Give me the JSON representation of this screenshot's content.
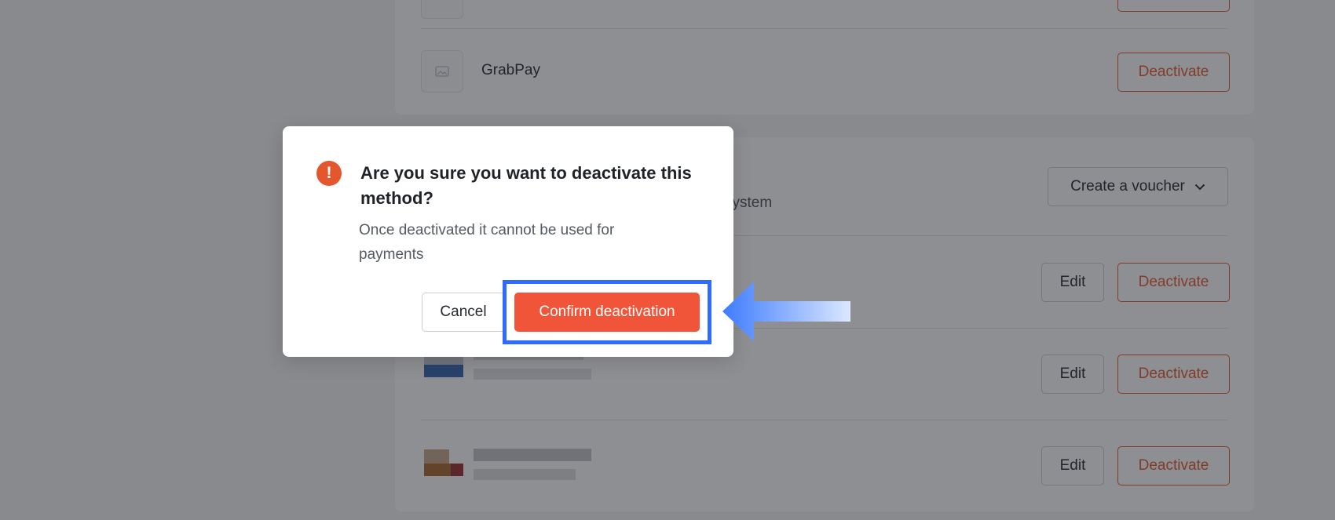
{
  "background": {
    "methods": [
      {
        "name": "GrabPay",
        "action_label": "Deactivate"
      }
    ],
    "voucher_section": {
      "subtitle_fragment": "system",
      "create_voucher_label": "Create a voucher"
    },
    "row_actions": {
      "edit_label": "Edit",
      "deactivate_label": "Deactivate"
    }
  },
  "dialog": {
    "icon": "exclamation-circle-icon",
    "title": "Are you sure you want to deactivate this method?",
    "message": "Once deactivated it cannot be used for payments",
    "cancel_label": "Cancel",
    "confirm_label": "Confirm deactivation"
  },
  "annotation": {
    "highlight_color": "#2f6bff",
    "arrow_color": "#3d7bff"
  },
  "colors": {
    "accent": "#e4572e",
    "confirm_bg": "#f0553a"
  }
}
